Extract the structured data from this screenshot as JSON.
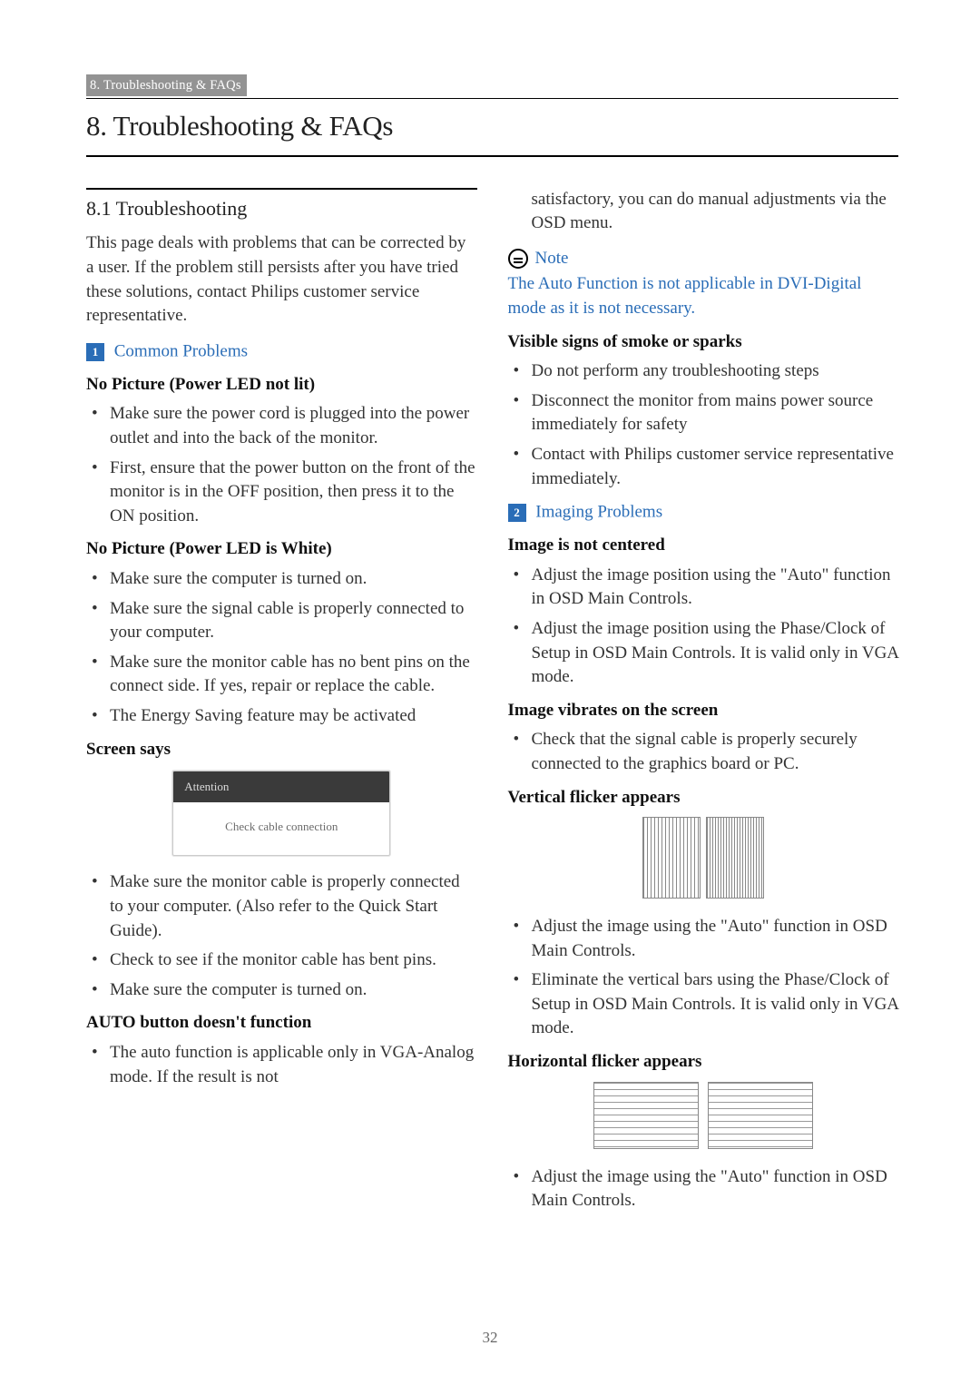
{
  "breadcrumb": "8. Troubleshooting & FAQs",
  "chapter_title": "8.  Troubleshooting & FAQs",
  "page_number": "32",
  "left": {
    "section_title": "8.1  Troubleshooting",
    "intro": "This page deals with problems that can be corrected by a user. If the problem still persists after you have tried these solutions, contact Philips customer service representative.",
    "group1": {
      "badge": "1",
      "label": "Common Problems"
    },
    "h1": "No Picture (Power LED not lit)",
    "b1": [
      "Make sure the power cord is plugged into the power outlet and into the back of the monitor.",
      "First, ensure that the power button on the front of the monitor is in the OFF position, then press it to the ON position."
    ],
    "h2": "No Picture (Power LED is White)",
    "b2": [
      "Make sure the computer is turned on.",
      "Make sure the signal cable is properly connected to your computer.",
      "Make sure the monitor cable has no bent pins on the connect side. If yes, repair or replace the cable.",
      "The Energy Saving feature may be activated"
    ],
    "h3": "Screen says",
    "attention": {
      "title": "Attention",
      "body": "Check cable connection"
    },
    "b3": [
      "Make sure the monitor cable is properly connected to your computer. (Also refer to the Quick Start Guide).",
      "Check to see if the monitor cable has bent pins.",
      "Make sure the computer is turned on."
    ],
    "h4": "AUTO button doesn't function",
    "b4": [
      "The auto function is applicable only in VGA-Analog mode.  If the result is not"
    ]
  },
  "right": {
    "cont": "satisfactory, you can do manual adjustments via the OSD menu.",
    "note_label": "Note",
    "note_text": "The Auto Function is not applicable in DVI-Digital mode as it is not necessary.",
    "h1": "Visible signs of smoke or sparks",
    "b1": [
      "Do not perform any troubleshooting steps",
      "Disconnect the monitor from mains power source immediately for safety",
      "Contact with Philips customer service representative immediately."
    ],
    "group2": {
      "badge": "2",
      "label": "Imaging Problems"
    },
    "h2": "Image is not centered",
    "b2": [
      "Adjust the image position using the \"Auto\" function in OSD Main Controls.",
      "Adjust the image position using the Phase/Clock of Setup in OSD Main Controls.  It is valid only in VGA mode."
    ],
    "h3": "Image vibrates on the screen",
    "b3": [
      "Check that the signal cable is properly securely connected to the graphics board or PC."
    ],
    "h4": "Vertical flicker appears",
    "b4": [
      "Adjust the image using the \"Auto\" function in OSD Main Controls.",
      "Eliminate the vertical bars using the Phase/Clock of Setup in OSD Main Controls. It is valid only in VGA mode."
    ],
    "h5": "Horizontal flicker appears",
    "b5": [
      "Adjust the image using the \"Auto\" function in OSD Main Controls."
    ]
  }
}
